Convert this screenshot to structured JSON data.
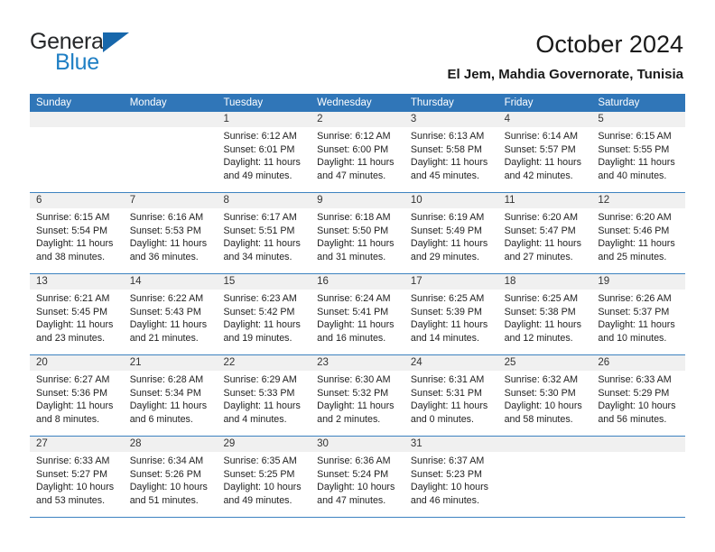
{
  "brand": {
    "name_top": "General",
    "name_bottom": "Blue",
    "accent_color": "#1f7fc4",
    "triangle_color": "#1767ab"
  },
  "header": {
    "title": "October 2024",
    "subtitle": "El Jem, Mahdia Governorate, Tunisia"
  },
  "theme": {
    "header_row_bg": "#3076b8",
    "daynum_strip_bg": "#f0f0f0",
    "row_divider": "#3d82c0",
    "text": "#222222"
  },
  "calendar": {
    "weekday_headers": [
      "Sunday",
      "Monday",
      "Tuesday",
      "Wednesday",
      "Thursday",
      "Friday",
      "Saturday"
    ],
    "weeks": [
      [
        {
          "day": "",
          "lines": []
        },
        {
          "day": "",
          "lines": []
        },
        {
          "day": "1",
          "lines": [
            "Sunrise: 6:12 AM",
            "Sunset: 6:01 PM",
            "Daylight: 11 hours",
            "and 49 minutes."
          ]
        },
        {
          "day": "2",
          "lines": [
            "Sunrise: 6:12 AM",
            "Sunset: 6:00 PM",
            "Daylight: 11 hours",
            "and 47 minutes."
          ]
        },
        {
          "day": "3",
          "lines": [
            "Sunrise: 6:13 AM",
            "Sunset: 5:58 PM",
            "Daylight: 11 hours",
            "and 45 minutes."
          ]
        },
        {
          "day": "4",
          "lines": [
            "Sunrise: 6:14 AM",
            "Sunset: 5:57 PM",
            "Daylight: 11 hours",
            "and 42 minutes."
          ]
        },
        {
          "day": "5",
          "lines": [
            "Sunrise: 6:15 AM",
            "Sunset: 5:55 PM",
            "Daylight: 11 hours",
            "and 40 minutes."
          ]
        }
      ],
      [
        {
          "day": "6",
          "lines": [
            "Sunrise: 6:15 AM",
            "Sunset: 5:54 PM",
            "Daylight: 11 hours",
            "and 38 minutes."
          ]
        },
        {
          "day": "7",
          "lines": [
            "Sunrise: 6:16 AM",
            "Sunset: 5:53 PM",
            "Daylight: 11 hours",
            "and 36 minutes."
          ]
        },
        {
          "day": "8",
          "lines": [
            "Sunrise: 6:17 AM",
            "Sunset: 5:51 PM",
            "Daylight: 11 hours",
            "and 34 minutes."
          ]
        },
        {
          "day": "9",
          "lines": [
            "Sunrise: 6:18 AM",
            "Sunset: 5:50 PM",
            "Daylight: 11 hours",
            "and 31 minutes."
          ]
        },
        {
          "day": "10",
          "lines": [
            "Sunrise: 6:19 AM",
            "Sunset: 5:49 PM",
            "Daylight: 11 hours",
            "and 29 minutes."
          ]
        },
        {
          "day": "11",
          "lines": [
            "Sunrise: 6:20 AM",
            "Sunset: 5:47 PM",
            "Daylight: 11 hours",
            "and 27 minutes."
          ]
        },
        {
          "day": "12",
          "lines": [
            "Sunrise: 6:20 AM",
            "Sunset: 5:46 PM",
            "Daylight: 11 hours",
            "and 25 minutes."
          ]
        }
      ],
      [
        {
          "day": "13",
          "lines": [
            "Sunrise: 6:21 AM",
            "Sunset: 5:45 PM",
            "Daylight: 11 hours",
            "and 23 minutes."
          ]
        },
        {
          "day": "14",
          "lines": [
            "Sunrise: 6:22 AM",
            "Sunset: 5:43 PM",
            "Daylight: 11 hours",
            "and 21 minutes."
          ]
        },
        {
          "day": "15",
          "lines": [
            "Sunrise: 6:23 AM",
            "Sunset: 5:42 PM",
            "Daylight: 11 hours",
            "and 19 minutes."
          ]
        },
        {
          "day": "16",
          "lines": [
            "Sunrise: 6:24 AM",
            "Sunset: 5:41 PM",
            "Daylight: 11 hours",
            "and 16 minutes."
          ]
        },
        {
          "day": "17",
          "lines": [
            "Sunrise: 6:25 AM",
            "Sunset: 5:39 PM",
            "Daylight: 11 hours",
            "and 14 minutes."
          ]
        },
        {
          "day": "18",
          "lines": [
            "Sunrise: 6:25 AM",
            "Sunset: 5:38 PM",
            "Daylight: 11 hours",
            "and 12 minutes."
          ]
        },
        {
          "day": "19",
          "lines": [
            "Sunrise: 6:26 AM",
            "Sunset: 5:37 PM",
            "Daylight: 11 hours",
            "and 10 minutes."
          ]
        }
      ],
      [
        {
          "day": "20",
          "lines": [
            "Sunrise: 6:27 AM",
            "Sunset: 5:36 PM",
            "Daylight: 11 hours",
            "and 8 minutes."
          ]
        },
        {
          "day": "21",
          "lines": [
            "Sunrise: 6:28 AM",
            "Sunset: 5:34 PM",
            "Daylight: 11 hours",
            "and 6 minutes."
          ]
        },
        {
          "day": "22",
          "lines": [
            "Sunrise: 6:29 AM",
            "Sunset: 5:33 PM",
            "Daylight: 11 hours",
            "and 4 minutes."
          ]
        },
        {
          "day": "23",
          "lines": [
            "Sunrise: 6:30 AM",
            "Sunset: 5:32 PM",
            "Daylight: 11 hours",
            "and 2 minutes."
          ]
        },
        {
          "day": "24",
          "lines": [
            "Sunrise: 6:31 AM",
            "Sunset: 5:31 PM",
            "Daylight: 11 hours",
            "and 0 minutes."
          ]
        },
        {
          "day": "25",
          "lines": [
            "Sunrise: 6:32 AM",
            "Sunset: 5:30 PM",
            "Daylight: 10 hours",
            "and 58 minutes."
          ]
        },
        {
          "day": "26",
          "lines": [
            "Sunrise: 6:33 AM",
            "Sunset: 5:29 PM",
            "Daylight: 10 hours",
            "and 56 minutes."
          ]
        }
      ],
      [
        {
          "day": "27",
          "lines": [
            "Sunrise: 6:33 AM",
            "Sunset: 5:27 PM",
            "Daylight: 10 hours",
            "and 53 minutes."
          ]
        },
        {
          "day": "28",
          "lines": [
            "Sunrise: 6:34 AM",
            "Sunset: 5:26 PM",
            "Daylight: 10 hours",
            "and 51 minutes."
          ]
        },
        {
          "day": "29",
          "lines": [
            "Sunrise: 6:35 AM",
            "Sunset: 5:25 PM",
            "Daylight: 10 hours",
            "and 49 minutes."
          ]
        },
        {
          "day": "30",
          "lines": [
            "Sunrise: 6:36 AM",
            "Sunset: 5:24 PM",
            "Daylight: 10 hours",
            "and 47 minutes."
          ]
        },
        {
          "day": "31",
          "lines": [
            "Sunrise: 6:37 AM",
            "Sunset: 5:23 PM",
            "Daylight: 10 hours",
            "and 46 minutes."
          ]
        },
        {
          "day": "",
          "lines": []
        },
        {
          "day": "",
          "lines": []
        }
      ]
    ]
  }
}
